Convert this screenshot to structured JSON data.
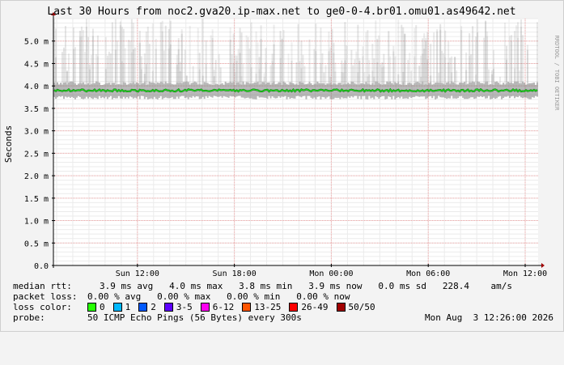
{
  "chart_data": {
    "type": "line",
    "title": "Last 30 Hours from noc2.gva20.ip-max.net to ge0-0-4.br01.omu01.as49642.net",
    "ylabel": "Seconds",
    "ylim": [
      0,
      5.5
    ],
    "yticks": [
      "0.0",
      "0.5 m",
      "1.0 m",
      "1.5 m",
      "2.0 m",
      "2.5 m",
      "3.0 m",
      "3.5 m",
      "4.0 m",
      "4.5 m",
      "5.0 m"
    ],
    "ytick_values": [
      0,
      0.5,
      1.0,
      1.5,
      2.0,
      2.5,
      3.0,
      3.5,
      4.0,
      4.5,
      5.0
    ],
    "xticks": [
      "Sun 12:00",
      "Sun 18:00",
      "Mon 00:00",
      "Mon 06:00",
      "Mon 12:00"
    ],
    "xtick_hours": [
      5.2,
      11.2,
      17.2,
      23.2,
      29.2
    ],
    "xlim_hours": [
      0,
      30
    ],
    "grid": true,
    "series": [
      {
        "name": "median rtt",
        "color": "#22dd22",
        "level_ms": 3.9,
        "min_ms": 3.8,
        "max_ms": 4.0
      }
    ],
    "smoke": {
      "color": "#808080",
      "band_low_ms": 3.7,
      "band_high_ms": 4.1,
      "spike_max_ms": 5.5
    }
  },
  "watermark": "RRDTOOL / TOBI OETIKER",
  "stats": {
    "median_rtt_label": "median rtt:",
    "median_rtt_value": "3.9 ms avg   4.0 ms max   3.8 ms min   3.9 ms now   0.0 ms sd   228.4    am/s",
    "packet_loss_label": "packet loss:",
    "packet_loss_value": "0.00 % avg   0.00 % max   0.00 % min   0.00 % now",
    "loss_color_label": "loss color:",
    "loss_colors": [
      {
        "label": "0",
        "color": "#26ff00"
      },
      {
        "label": "1",
        "color": "#00b8ff"
      },
      {
        "label": "2",
        "color": "#0059ff"
      },
      {
        "label": "3-5",
        "color": "#5e00ff"
      },
      {
        "label": "6-12",
        "color": "#ff00ef"
      },
      {
        "label": "13-25",
        "color": "#ff5500"
      },
      {
        "label": "26-49",
        "color": "#ff0000"
      },
      {
        "label": "50/50",
        "color": "#a10000"
      }
    ],
    "probe_label": "probe:",
    "probe_value": "50 ICMP Echo Pings (56 Bytes) every 300s",
    "timestamp": "Mon Aug  3 12:26:00 2026"
  }
}
